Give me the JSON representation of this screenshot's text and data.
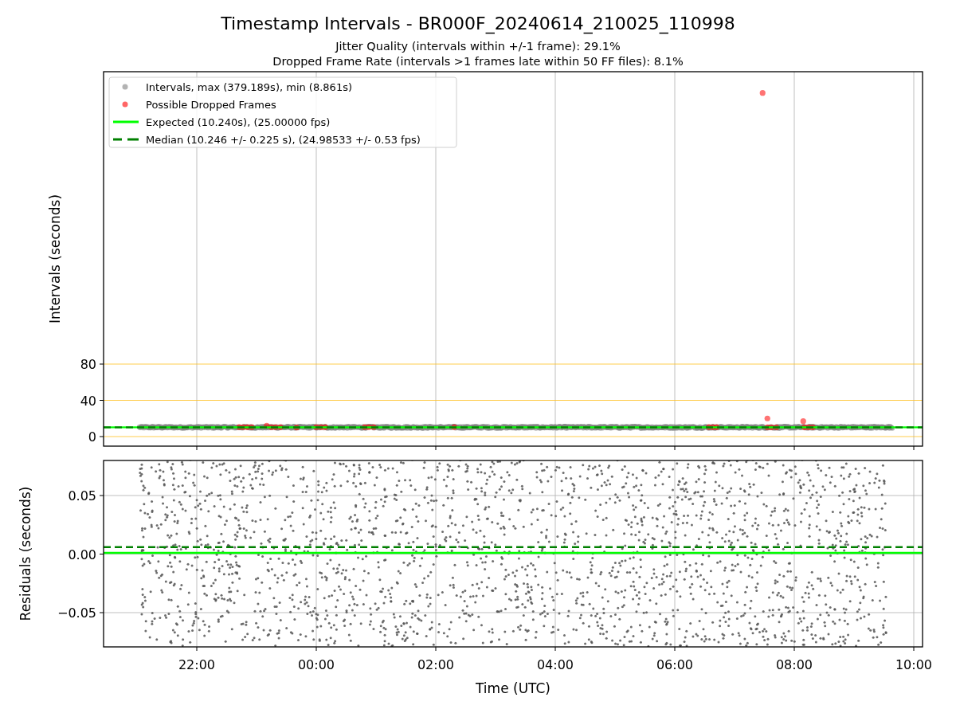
{
  "figure": {
    "title": "Timestamp Intervals - BR000F_20240614_210025_110998",
    "subtitles": [
      "Jitter Quality (intervals within +/-1 frame): 29.1%",
      "Dropped Frame Rate (intervals >1 frames late within 50 FF files): 8.1%"
    ]
  },
  "legend": [
    {
      "label": "Intervals, max (379.189s), min (8.861s)",
      "kind": "marker",
      "color": "#b3b3b3"
    },
    {
      "label": "Possible Dropped Frames",
      "kind": "marker",
      "color": "#ff6666"
    },
    {
      "label": "Expected (10.240s), (25.00000 fps)",
      "kind": "line",
      "color": "#00ff00"
    },
    {
      "label": "Median (10.246 +/- 0.225 s), (24.98533 +/- 0.53 fps)",
      "kind": "dashed",
      "color": "#008000"
    }
  ],
  "intervals_panel": {
    "ylabel": "Intervals (seconds)",
    "yticks": [
      "80",
      "40",
      "0"
    ]
  },
  "residuals_panel": {
    "ylabel": "Residuals (seconds)",
    "yticks": [
      "0.05",
      "0.00",
      "−0.05"
    ],
    "xticks": [
      "22:00",
      "00:00",
      "02:00",
      "04:00",
      "06:00",
      "08:00",
      "10:00"
    ],
    "xlabel": "Time (UTC)"
  }
}
